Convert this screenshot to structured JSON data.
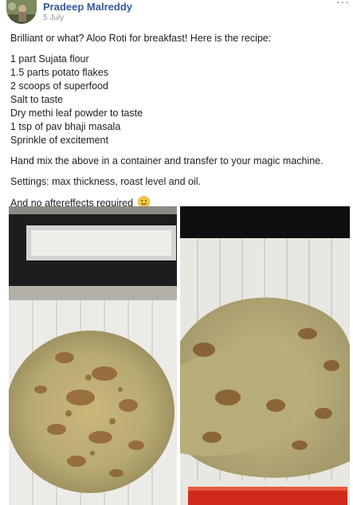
{
  "post": {
    "author": "Pradeep Malreddy",
    "date": "5 July",
    "more_label": "···",
    "intro": "Brilliant or what? Aloo Roti for breakfast! Here is the recipe:",
    "ingredients": [
      "1 part Sujata flour",
      "1.5 parts potato flakes",
      "2 scoops of superfood",
      "Salt to taste",
      "Dry methi leaf powder to taste",
      "1 tsp of pav bhaji masala",
      "Sprinkle of excitement"
    ],
    "instructions": "Hand mix the above in a container and transfer to your magic machine.",
    "settings": "Settings: max thickness, roast level and oil.",
    "closing": "And no aftereffects required"
  },
  "icons": {
    "smiley": "smiley-emoji-icon",
    "more": "more-options-icon"
  },
  "colors": {
    "author_link": "#365899",
    "meta_text": "#90949c",
    "body_text": "#1c1e21"
  }
}
